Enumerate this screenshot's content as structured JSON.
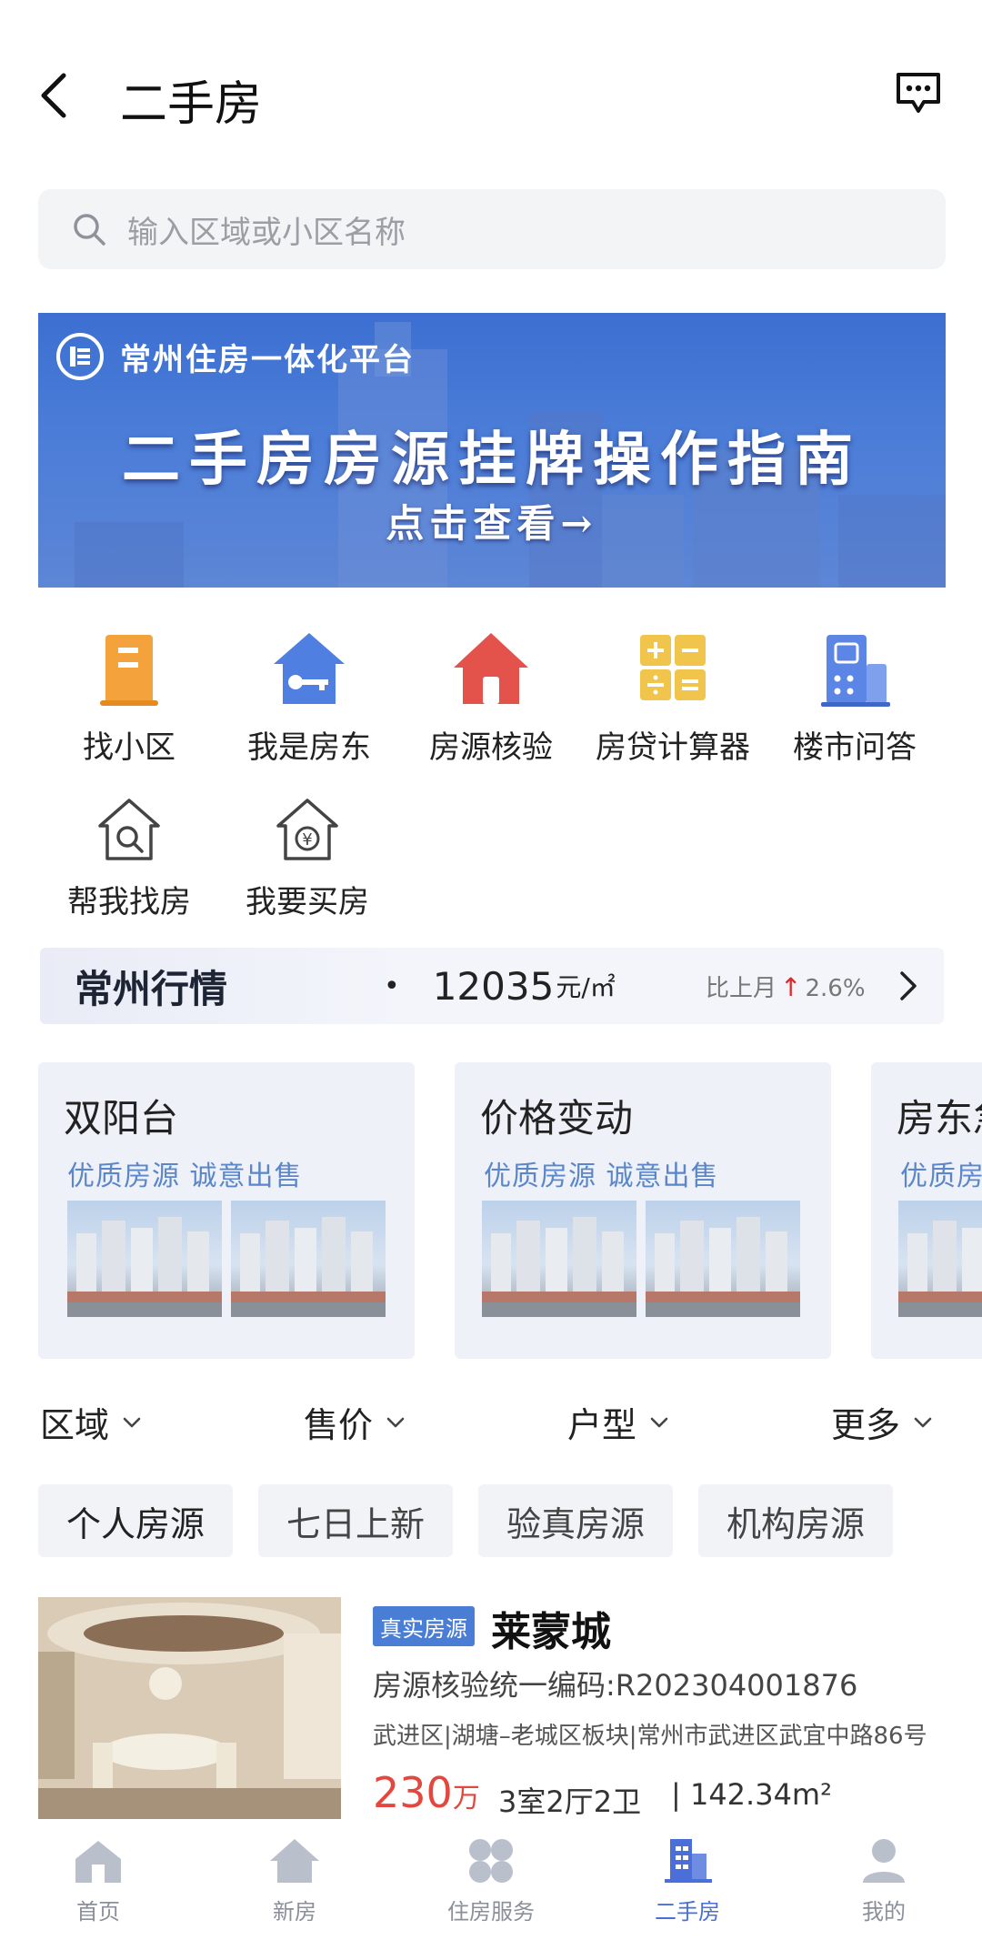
{
  "header": {
    "title": "二手房",
    "back_icon": "chevron-left-icon",
    "message_icon": "chat-bubble-icon"
  },
  "search": {
    "placeholder": "输入区域或小区名称"
  },
  "banner": {
    "platform": "常州住房一体化平台",
    "headline": "二手房房源挂牌操作指南",
    "cta": "点击查看→"
  },
  "quick_actions": [
    {
      "label": "找小区",
      "icon": "building-icon",
      "color": "#f4a23b"
    },
    {
      "label": "我是房东",
      "icon": "house-key-icon",
      "color": "#4f7fe0"
    },
    {
      "label": "房源核验",
      "icon": "house-check-icon",
      "color": "#e4524c"
    },
    {
      "label": "房贷计算器",
      "icon": "calculator-icon",
      "color": "#f1c44b"
    },
    {
      "label": "楼市问答",
      "icon": "qa-building-icon",
      "color": "#5c86e6"
    },
    {
      "label": "帮我找房",
      "icon": "house-search-icon",
      "color": "#444444"
    },
    {
      "label": "我要买房",
      "icon": "house-yuan-icon",
      "color": "#444444"
    }
  ],
  "market": {
    "title": "常州行情",
    "price": "12035",
    "unit": "元/㎡",
    "compare_label": "比上月",
    "change": "2.6%"
  },
  "feature_cards": [
    {
      "title": "双阳台",
      "subtitle": "优质房源 诚意出售"
    },
    {
      "title": "价格变动",
      "subtitle": "优质房源 诚意出售"
    },
    {
      "title": "房东急",
      "subtitle": "优质房源"
    }
  ],
  "filters": [
    {
      "label": "区域"
    },
    {
      "label": "售价"
    },
    {
      "label": "户型"
    },
    {
      "label": "更多"
    }
  ],
  "tags": [
    "个人房源",
    "七日上新",
    "验真房源",
    "机构房源"
  ],
  "listing": {
    "badge": "真实房源",
    "name": "莱蒙城",
    "code": "房源核验统一编码:R202304001876",
    "address": "武进区|湖塘–老城区板块|常州市武进区武宜中路86号",
    "price": "230",
    "price_unit": "万",
    "layout": "3室2厅2卫",
    "area": "| 142.34m²"
  },
  "bottom_nav": [
    {
      "label": "首页",
      "icon": "home-icon"
    },
    {
      "label": "新房",
      "icon": "house-icon"
    },
    {
      "label": "住房服务",
      "icon": "services-icon"
    },
    {
      "label": "二手房",
      "icon": "building-icon",
      "active": true
    },
    {
      "label": "我的",
      "icon": "user-icon"
    }
  ],
  "colors": {
    "accent": "#4a6fd8",
    "price": "#e3483f",
    "up_arrow": "#e02a2a"
  }
}
